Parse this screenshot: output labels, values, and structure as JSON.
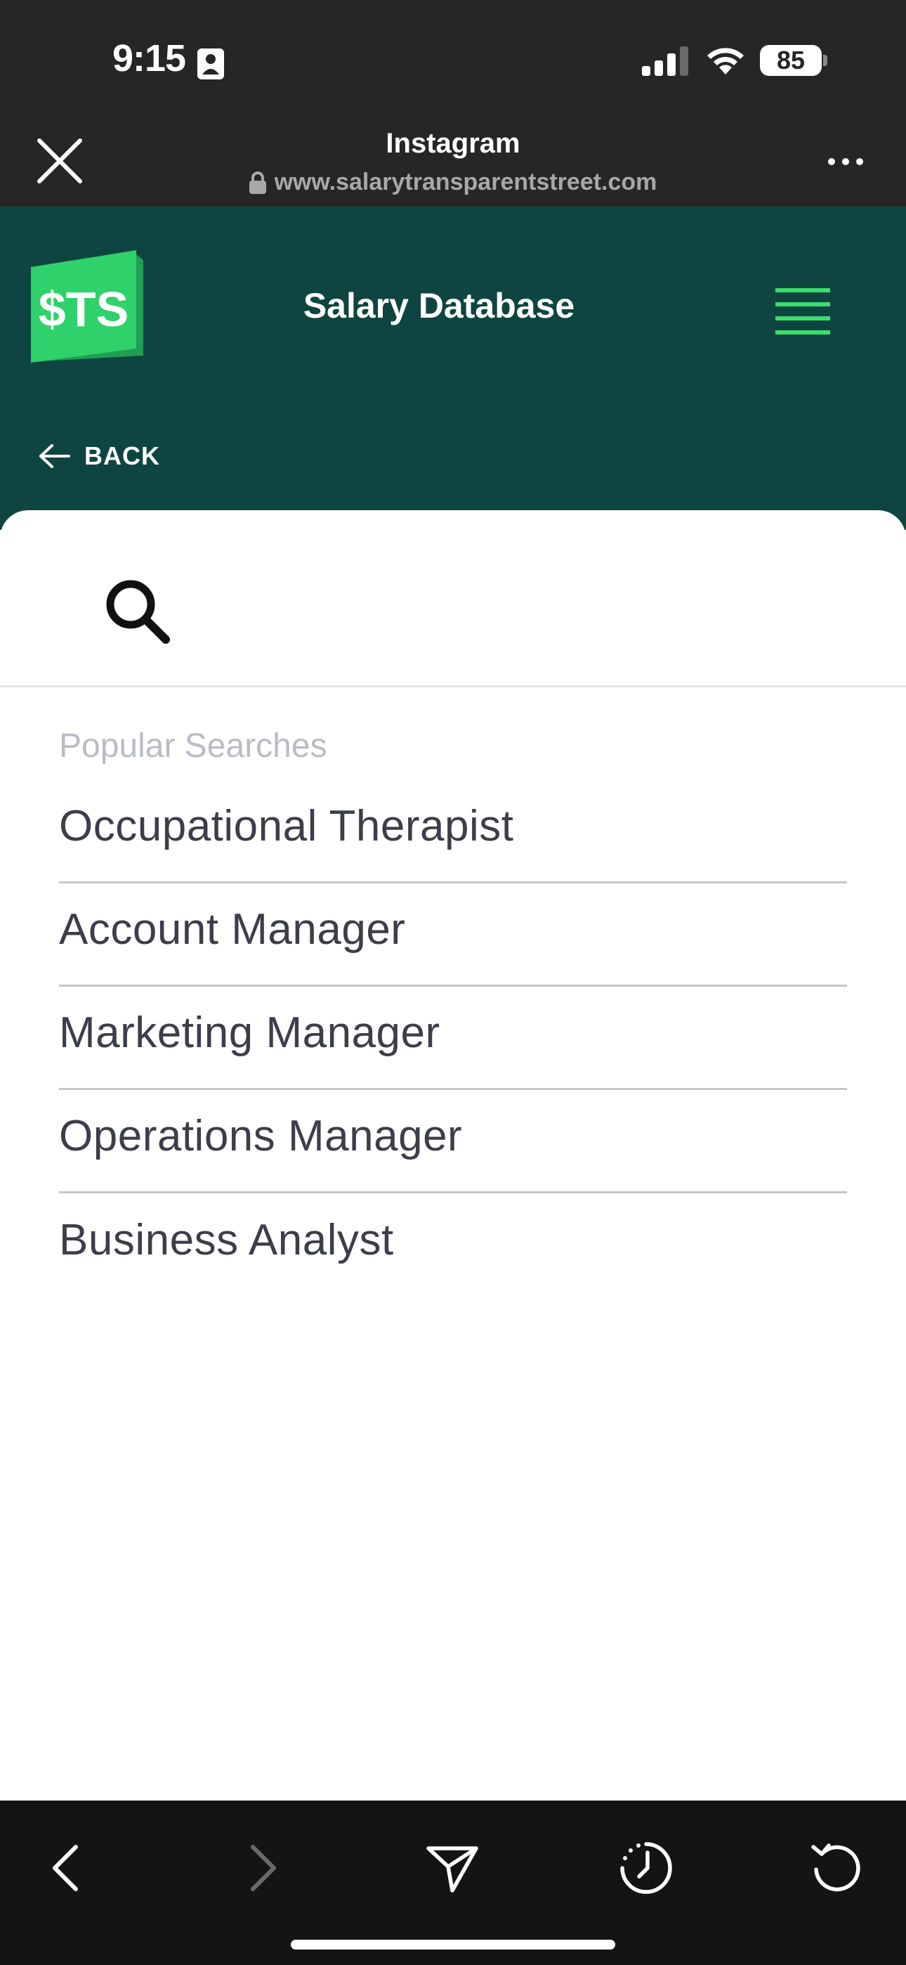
{
  "status_bar": {
    "time": "9:15",
    "battery": "85"
  },
  "browser": {
    "title": "Instagram",
    "url": "www.salarytransparentstreet.com"
  },
  "site": {
    "logo_text": "$TS",
    "title": "Salary Database",
    "back_label": "BACK",
    "accent": "#3ddc6e",
    "header_bg": "#0f4540"
  },
  "search": {
    "placeholder": "",
    "popular_label": "Popular Searches"
  },
  "popular_searches": [
    "Occupational Therapist",
    "Account Manager",
    "Marketing Manager",
    "Operations Manager",
    "Business Analyst"
  ],
  "toolbar": {
    "icons": [
      "back-icon",
      "forward-icon",
      "share-icon",
      "history-icon",
      "reload-icon"
    ]
  }
}
